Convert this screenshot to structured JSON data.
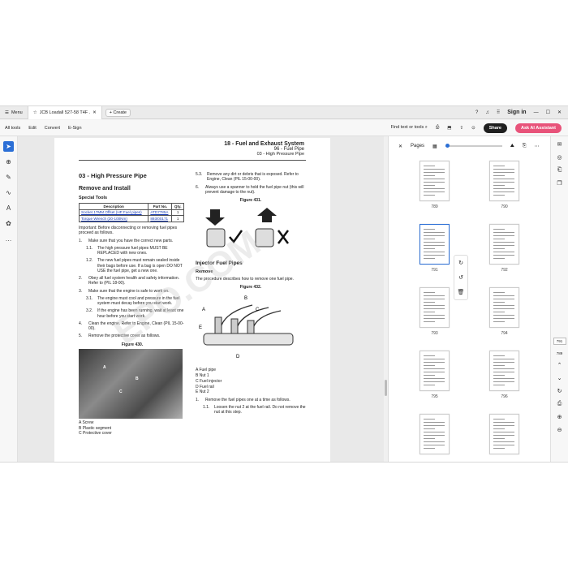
{
  "titlebar": {
    "menu_label": "Menu",
    "tab_title": "JCB Loadall 527-58 T4F ...",
    "create_label": "Create",
    "signin_label": "Sign in"
  },
  "toolbar": {
    "items": [
      "All tools",
      "Edit",
      "Convert",
      "E-Sign"
    ],
    "find_label": "Find text or tools",
    "share_label": "Share",
    "ai_label": "Ask AI Assistant"
  },
  "document": {
    "header_title": "18 - Fuel and Exhaust System",
    "header_sub": "96 - Fuel Pipe",
    "header_sub2": "03 - High Pressure Pipe",
    "section_title": "03 - High Pressure Pipe",
    "subsection": "Remove and Install",
    "special_tools": "Special Tools",
    "table_headers": [
      "Description",
      "Part No.",
      "Qty."
    ],
    "table_rows": [
      [
        "Socket 17MM Offset (HP Fuel pipes)",
        "ATD7785A",
        "1"
      ],
      [
        "Torque Wrench (20-100Nm)",
        "893/00171",
        "1"
      ]
    ],
    "important": "Important: Before disconnecting or removing fuel pipes proceed as follows.",
    "step1": "Make sure that you have the correct new parts.",
    "step1_1": "The high pressure fuel pipes MUST BE REPLACED with new ones.",
    "step1_2": "The new fuel pipes must remain sealed inside their bags before use. If a bag is open DO NOT USE the fuel pipe, get a new one.",
    "step2": "Obey all fuel system health and safety information. Refer to (PIL 18-00).",
    "step3": "Make sure that the engine is safe to work on.",
    "step3_1": "The engine must cool and pressure in the fuel system must decay before you start work.",
    "step3_2": "If the engine has been running, wait at least one hour before you start work.",
    "step4": "Clean the engine. Refer to Engine, Clean (PIL 15-00-00).",
    "step5": "Remove the protective cover as follows.",
    "fig430": "Figure 430.",
    "legend430": [
      "A  Screw",
      "B  Plastic segment",
      "C  Protective cover"
    ],
    "step5_3": "Remove any dirt or debris that is exposed. Refer to Engine, Clean (PIL 15-00-00).",
    "step6": "Always use a spanner to hold the fuel pipe nut (this will prevent damage to the nut).",
    "fig431": "Figure 431.",
    "injector_title": "Injector Fuel Pipes",
    "remove_title": "Remove",
    "remove_text": "The procedure describes how to remove one fuel pipe.",
    "fig432": "Figure 432.",
    "legend432": [
      "A  Fuel pipe",
      "B  Nut 1",
      "C  Fuel injector",
      "D  Fuel rail",
      "E  Nut 2"
    ],
    "rstep1": "Remove the fuel pipes one at a time as follows.",
    "rstep1_1": "Loosen the nut 2 at the fuel rail. Do not remove the nut at this step.",
    "watermark": "EPO.COM"
  },
  "panel": {
    "title": "Pages",
    "thumbs": [
      "789",
      "790",
      "791",
      "792",
      "793",
      "794",
      "795",
      "796"
    ]
  },
  "right_rail": {
    "page_current": "791",
    "page_total": "789"
  }
}
